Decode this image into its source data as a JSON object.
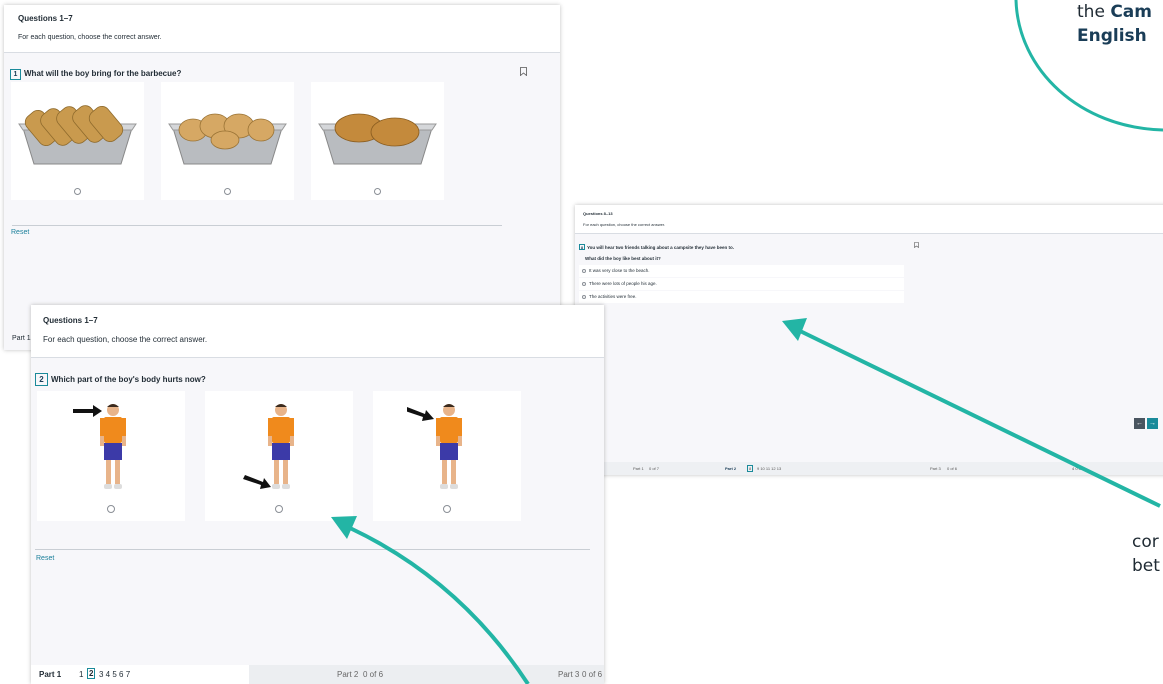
{
  "brand_color": "#23b5a5",
  "card1": {
    "title": "Questions 1–7",
    "subtitle": "For each question, choose the correct answer.",
    "q_number": "1",
    "question": "What will the boy bring for the barbecue?",
    "reset": "Reset",
    "part_stub": "Part 1",
    "options": [
      "sausages",
      "chicken",
      "burgers"
    ]
  },
  "card2": {
    "title": "Questions 8–13",
    "subtitle": "For each question, choose the correct answer.",
    "q_number": "8",
    "question": "You will hear two friends talking about a campsite they have been to.",
    "sub_question": "What did the boy like best about it?",
    "options": [
      "It was very close to the beach.",
      "There were lots of people his age.",
      "The activities were free."
    ],
    "footer": {
      "part1": "Part 1",
      "part1_count": "0 of 7",
      "part2": "Part 2",
      "part2_current": "8",
      "part2_pages": "9  10  11  12  13",
      "part3": "Part 3",
      "part3_count": "0 of 6",
      "part4_count": "4  0 of 6"
    },
    "nav_prev": "←",
    "nav_next": "→"
  },
  "card3": {
    "title": "Questions 1–7",
    "subtitle": "For each question, choose the correct answer.",
    "q_number": "2",
    "question": "Which part of the boy's body hurts now?",
    "reset": "Reset",
    "footer": {
      "part1": "Part 1",
      "page_before": "1",
      "page_current": "2",
      "pages_after": "3  4  5  6  7",
      "part2": "Part 2",
      "part2_count": "0 of 6",
      "part3": "Part 3",
      "part3_count": "0 of 6"
    }
  },
  "callout_top": {
    "line1_prefix": "the ",
    "line1_bold": "Cam",
    "line2_bold": "English"
  },
  "callout_right": {
    "line1": "cor",
    "line2": "bet"
  }
}
